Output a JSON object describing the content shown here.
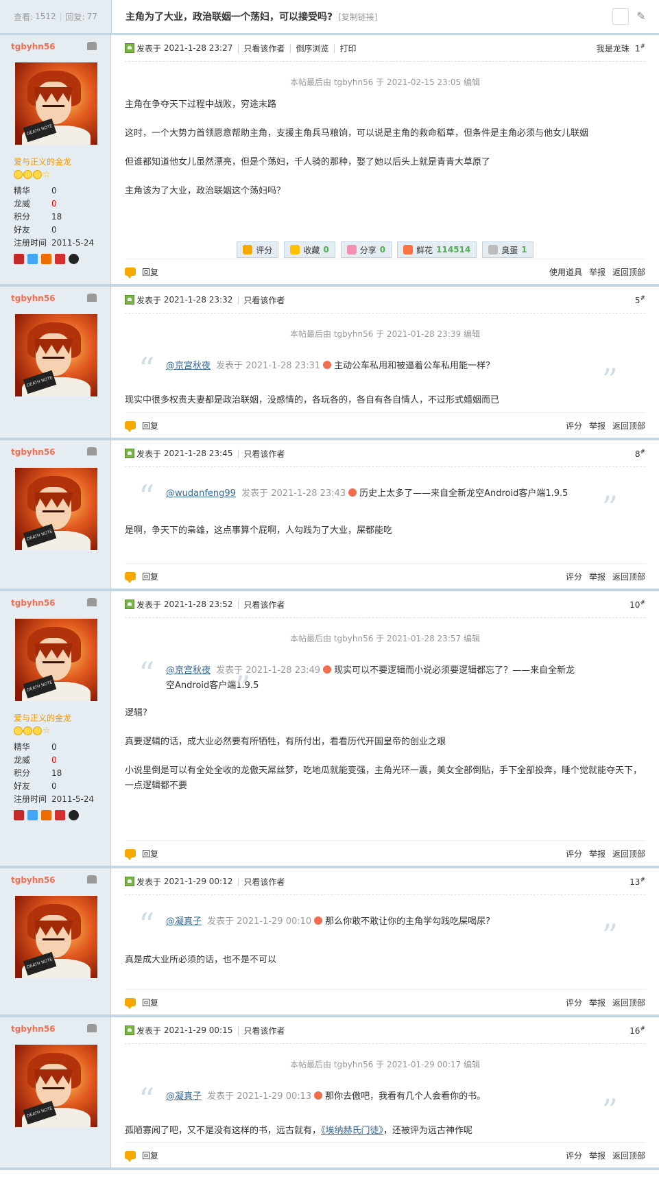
{
  "header": {
    "views_label": "查看:",
    "views": "1512",
    "replies_label": "回复:",
    "replies": "77",
    "title": "主角为了大业，政治联姻一个荡妇，可以接受吗?",
    "copy_link": "[复制链接]"
  },
  "labels": {
    "posted_at": "发表于",
    "only_author": "只看该作者",
    "reverse": "倒序浏览",
    "print": "打印",
    "reply": "回复",
    "rate": "评分",
    "report": "举报",
    "back_top": "返回顶部",
    "use_tool": "使用道具",
    "stat_jinghua": "精华",
    "stat_longwei": "龙威",
    "stat_jifen": "积分",
    "stat_haoyou": "好友",
    "stat_reg": "注册时间"
  },
  "author": {
    "name": "tgbyhn56",
    "title": "爱与正义的金龙",
    "jinghua": "0",
    "longwei": "0",
    "jifen": "18",
    "haoyou": "0",
    "reg": "2011-5-24"
  },
  "post1": {
    "time": "2021-1-28 23:27",
    "floor_label": "我是龙珠",
    "floor_num": "1",
    "edit": "本帖最后由 tgbyhn56 于 2021-02-15 23:05 编辑",
    "p1": "主角在争夺天下过程中战败，穷途末路",
    "p2": "这时，一个大势力首领愿意帮助主角，支援主角兵马粮饷，可以说是主角的救命稻草，但条件是主角必须与他女儿联姻",
    "p3": "但谁都知道他女儿虽然漂亮，但是个荡妇，千人骑的那种，娶了她以后头上就是青青大草原了",
    "p4": "主角该为了大业，政治联姻这个荡妇吗？",
    "btn_rate": "评分",
    "btn_fav": "收藏",
    "fav_n": "0",
    "btn_share": "分享",
    "share_n": "0",
    "btn_flower": "鲜花",
    "flower_n": "114514",
    "btn_egg": "臭蛋",
    "egg_n": "1"
  },
  "post5": {
    "time": "2021-1-28 23:32",
    "floor": "5",
    "edit": "本帖最后由 tgbyhn56 于 2021-01-28 23:39 编辑",
    "q_user": "@京宫秋夜",
    "q_time": "发表于 2021-1-28 23:31",
    "q_text": "主动公车私用和被逼着公车私用能一样？",
    "text": "现实中很多权贵夫妻都是政治联姻，没感情的，各玩各的，各自有各自情人，不过形式婚姻而已"
  },
  "post8": {
    "time": "2021-1-28 23:45",
    "floor": "8",
    "q_user": "@wudanfeng99",
    "q_time": "发表于 2021-1-28 23:43",
    "q_text": "历史上太多了——来自全新龙空Android客户端1.9.5",
    "text": "是啊，争天下的枭雄，这点事算个屁啊，人勾践为了大业，屎都能吃"
  },
  "post10": {
    "time": "2021-1-28 23:52",
    "floor": "10",
    "edit": "本帖最后由 tgbyhn56 于 2021-01-28 23:57 编辑",
    "q_user": "@京宫秋夜",
    "q_time": "发表于 2021-1-28 23:49",
    "q_text": "现实可以不要逻辑而小说必须要逻辑都忘了？——来自全新龙空Android客户端1.9.5",
    "p1": "逻辑?",
    "p2": "真要逻辑的话，成大业必然要有所牺牲，有所付出，看看历代开国皇帝的创业之艰",
    "p3": "小说里倒是可以有全处全收的龙傲天屌丝梦，吃地瓜就能变强，主角光环一震，美女全部倒贴，手下全部投奔，睡个觉就能夺天下，一点逻辑都不要"
  },
  "post13": {
    "time": "2021-1-29 00:12",
    "floor": "13",
    "q_user": "@凝真子",
    "q_time": "发表于 2021-1-29 00:10",
    "q_text": "那么你敢不敢让你的主角学勾践吃屎喝尿?",
    "text": "真是成大业所必须的话，也不是不可以"
  },
  "post16": {
    "time": "2021-1-29 00:15",
    "floor": "16",
    "edit": "本帖最后由 tgbyhn56 于 2021-01-29 00:17 编辑",
    "q_user": "@凝真子",
    "q_time": "发表于 2021-1-29 00:13",
    "q_text": "那你去傲吧，我看有几个人会看你的书。",
    "text_a": "孤陋寡闻了吧，又不是没有这样的书，远古就有，",
    "link": "《埃纳赫氏门徒》",
    "text_b": "，还被评为远古神作呢"
  }
}
